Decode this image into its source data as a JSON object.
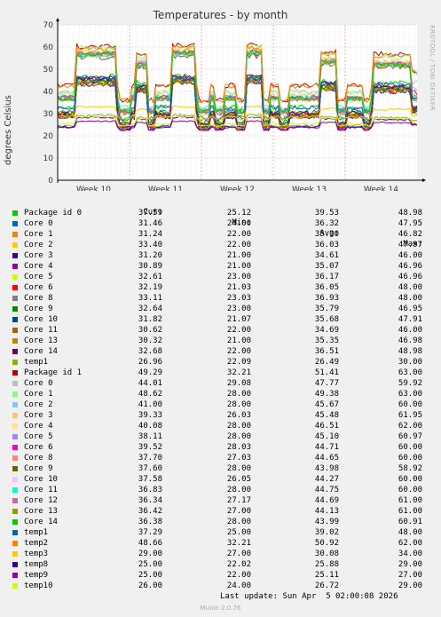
{
  "title": "Temperatures - by month",
  "side_label": "RRDTOOL / TOBI OETIKER",
  "chart_data": {
    "type": "line",
    "ylabel": "degrees Celsius",
    "ylim": [
      0,
      70
    ],
    "yticks": [
      0,
      10,
      20,
      30,
      40,
      50,
      60,
      70
    ],
    "xticks": [
      "Week 10",
      "Week 11",
      "Week 12",
      "Week 13",
      "Week 14"
    ],
    "grid": true,
    "series": [
      {
        "name": "Package id 0",
        "color": "#00cc00",
        "cur": "37.59",
        "min": "25.12",
        "avg": "39.53",
        "max": "48.98"
      },
      {
        "name": "Core 0",
        "color": "#0066b3",
        "cur": "31.46",
        "min": "24.00",
        "avg": "36.32",
        "max": "47.95"
      },
      {
        "name": "Core 1",
        "color": "#ff8000",
        "cur": "31.24",
        "min": "22.00",
        "avg": "35.30",
        "max": "46.82"
      },
      {
        "name": "Core 2",
        "color": "#ffcc00",
        "cur": "33.40",
        "min": "22.00",
        "avg": "36.03",
        "max": "47.97"
      },
      {
        "name": "Core 3",
        "color": "#330099",
        "cur": "31.20",
        "min": "21.00",
        "avg": "34.61",
        "max": "46.00"
      },
      {
        "name": "Core 4",
        "color": "#990099",
        "cur": "30.89",
        "min": "21.00",
        "avg": "35.07",
        "max": "46.96"
      },
      {
        "name": "Core 5",
        "color": "#ccff00",
        "cur": "32.61",
        "min": "23.00",
        "avg": "36.17",
        "max": "46.96"
      },
      {
        "name": "Core 6",
        "color": "#ff0000",
        "cur": "32.19",
        "min": "21.03",
        "avg": "36.05",
        "max": "48.00"
      },
      {
        "name": "Core 8",
        "color": "#808080",
        "cur": "33.11",
        "min": "23.03",
        "avg": "36.93",
        "max": "48.00"
      },
      {
        "name": "Core 9",
        "color": "#008f00",
        "cur": "32.64",
        "min": "23.00",
        "avg": "35.79",
        "max": "46.95"
      },
      {
        "name": "Core 10",
        "color": "#00487d",
        "cur": "31.82",
        "min": "21.07",
        "avg": "35.68",
        "max": "47.91"
      },
      {
        "name": "Core 11",
        "color": "#b35a00",
        "cur": "30.62",
        "min": "22.00",
        "avg": "34.69",
        "max": "46.00"
      },
      {
        "name": "Core 13",
        "color": "#b38f00",
        "cur": "30.32",
        "min": "21.00",
        "avg": "35.35",
        "max": "46.98"
      },
      {
        "name": "Core 14",
        "color": "#6b006b",
        "cur": "32.68",
        "min": "22.00",
        "avg": "36.51",
        "max": "48.98"
      },
      {
        "name": "temp1",
        "color": "#8fb300",
        "cur": "26.96",
        "min": "22.09",
        "avg": "26.49",
        "max": "30.00"
      },
      {
        "name": "Package id 1",
        "color": "#b30000",
        "cur": "49.29",
        "min": "32.21",
        "avg": "51.41",
        "max": "63.00"
      },
      {
        "name": "Core 0",
        "color": "#bebebe",
        "cur": "44.01",
        "min": "29.08",
        "avg": "47.77",
        "max": "59.92"
      },
      {
        "name": "Core 1",
        "color": "#80ff80",
        "cur": "48.62",
        "min": "28.00",
        "avg": "49.38",
        "max": "63.00"
      },
      {
        "name": "Core 2",
        "color": "#80c9ff",
        "cur": "41.00",
        "min": "28.00",
        "avg": "45.67",
        "max": "60.00"
      },
      {
        "name": "Core 3",
        "color": "#ffc080",
        "cur": "39.33",
        "min": "26.03",
        "avg": "45.48",
        "max": "61.95"
      },
      {
        "name": "Core 4",
        "color": "#ffe680",
        "cur": "40.08",
        "min": "28.00",
        "avg": "46.51",
        "max": "62.00"
      },
      {
        "name": "Core 5",
        "color": "#aa80ff",
        "cur": "38.11",
        "min": "28.00",
        "avg": "45.10",
        "max": "60.97"
      },
      {
        "name": "Core 6",
        "color": "#ee00cc",
        "cur": "39.52",
        "min": "28.03",
        "avg": "44.71",
        "max": "60.00"
      },
      {
        "name": "Core 8",
        "color": "#ff8080",
        "cur": "37.70",
        "min": "27.03",
        "avg": "44.65",
        "max": "60.00"
      },
      {
        "name": "Core 9",
        "color": "#666600",
        "cur": "37.60",
        "min": "28.00",
        "avg": "43.98",
        "max": "58.92"
      },
      {
        "name": "Core 10",
        "color": "#ffbfff",
        "cur": "37.58",
        "min": "26.05",
        "avg": "44.27",
        "max": "60.00"
      },
      {
        "name": "Core 11",
        "color": "#00ffcc",
        "cur": "36.83",
        "min": "28.00",
        "avg": "44.75",
        "max": "60.00"
      },
      {
        "name": "Core 12",
        "color": "#cc6699",
        "cur": "36.34",
        "min": "27.17",
        "avg": "44.69",
        "max": "61.00"
      },
      {
        "name": "Core 13",
        "color": "#999900",
        "cur": "36.42",
        "min": "27.00",
        "avg": "44.13",
        "max": "61.00"
      },
      {
        "name": "Core 14",
        "color": "#00cc00",
        "cur": "36.38",
        "min": "28.00",
        "avg": "43.99",
        "max": "60.91"
      },
      {
        "name": "temp1",
        "color": "#0066b3",
        "cur": "37.29",
        "min": "25.00",
        "avg": "39.02",
        "max": "48.00"
      },
      {
        "name": "temp2",
        "color": "#ff8000",
        "cur": "48.66",
        "min": "32.21",
        "avg": "50.92",
        "max": "62.00"
      },
      {
        "name": "temp3",
        "color": "#ffcc00",
        "cur": "29.00",
        "min": "27.00",
        "avg": "30.08",
        "max": "34.00"
      },
      {
        "name": "temp8",
        "color": "#330099",
        "cur": "25.00",
        "min": "22.02",
        "avg": "25.88",
        "max": "29.00"
      },
      {
        "name": "temp9",
        "color": "#990099",
        "cur": "25.00",
        "min": "22.00",
        "avg": "25.11",
        "max": "27.00"
      },
      {
        "name": "temp10",
        "color": "#ccff00",
        "cur": "26.00",
        "min": "24.00",
        "avg": "26.72",
        "max": "29.00"
      }
    ]
  },
  "legend_headers": {
    "cur": "Cur:",
    "min": "Min:",
    "avg": "Avg:",
    "max": "Max:"
  },
  "last_update": "Last update: Sun Apr  5 02:00:08 2026",
  "munin_version": "Munin 2.0.76"
}
